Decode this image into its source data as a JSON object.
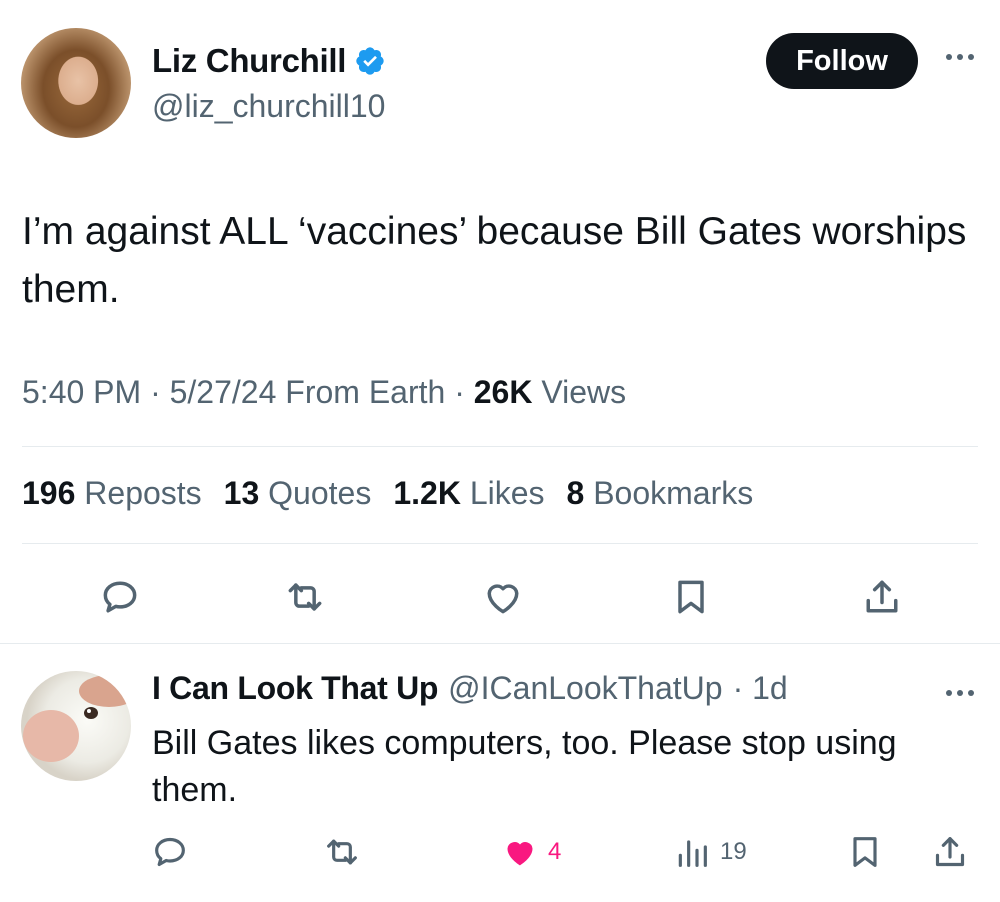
{
  "tweet": {
    "author": {
      "name": "Liz Churchill",
      "handle": "@liz_churchill10",
      "verified": true
    },
    "follow_label": "Follow",
    "text": "I’m against ALL ‘vaccines’ because Bill Gates worships them.",
    "time": "5:40 PM",
    "date": "5/27/24",
    "source": "From Earth",
    "views_count": "26K",
    "views_label": "Views",
    "stats": [
      {
        "count": "196",
        "label": "Reposts"
      },
      {
        "count": "13",
        "label": "Quotes"
      },
      {
        "count": "1.2K",
        "label": "Likes"
      },
      {
        "count": "8",
        "label": "Bookmarks"
      }
    ],
    "actions": [
      "reply-icon",
      "repost-icon",
      "like-icon",
      "bookmark-icon",
      "share-icon"
    ]
  },
  "reply": {
    "name": "I Can Look That Up",
    "handle": "@ICanLookThatUp",
    "age": "· 1d",
    "text": "Bill Gates likes computers, too. Please stop using them.",
    "likes": "4",
    "views": "19",
    "liked": true
  },
  "colors": {
    "text_primary": "#0f1419",
    "text_secondary": "#536471",
    "verified_blue": "#1d9bf0",
    "like_pink": "#f91880",
    "divider": "#e6ebee"
  }
}
